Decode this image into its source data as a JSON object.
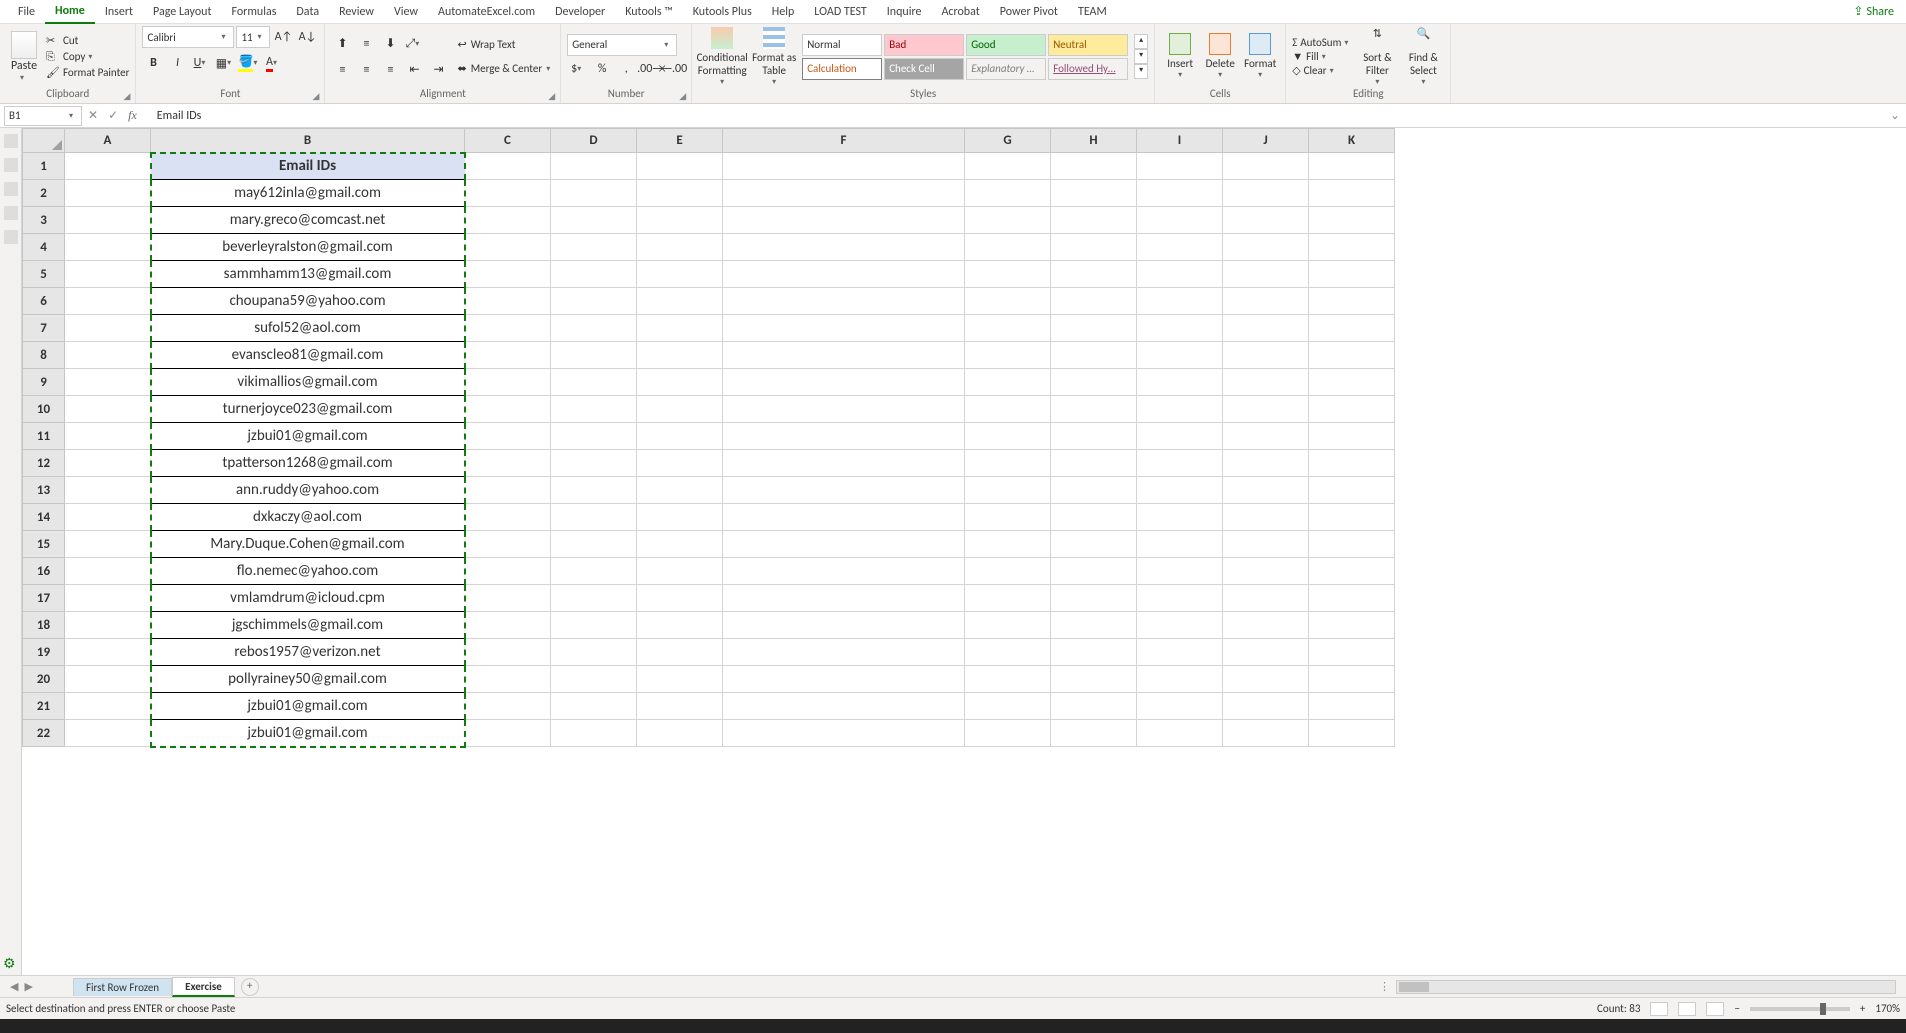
{
  "tabs": [
    "File",
    "Home",
    "Insert",
    "Page Layout",
    "Formulas",
    "Data",
    "Review",
    "View",
    "AutomateExcel.com",
    "Developer",
    "Kutools ™",
    "Kutools Plus",
    "Help",
    "LOAD TEST",
    "Inquire",
    "Acrobat",
    "Power Pivot",
    "TEAM"
  ],
  "active_tab": "Home",
  "share": "Share",
  "clipboard": {
    "paste": "Paste",
    "cut": "Cut",
    "copy": "Copy",
    "painter": "Format Painter",
    "label": "Clipboard"
  },
  "font": {
    "name": "Calibri",
    "size": "11",
    "label": "Font"
  },
  "alignment": {
    "wrap": "Wrap Text",
    "merge": "Merge & Center",
    "label": "Alignment"
  },
  "number": {
    "format": "General",
    "label": "Number"
  },
  "styles": {
    "cond": "Conditional Formatting",
    "table": "Format as Table",
    "g": [
      "Normal",
      "Bad",
      "Good",
      "Neutral",
      "Calculation",
      "Check Cell",
      "Explanatory …",
      "Followed Hy…"
    ],
    "label": "Styles"
  },
  "cells": {
    "insert": "Insert",
    "delete": "Delete",
    "format": "Format",
    "label": "Cells"
  },
  "editing": {
    "sum": "AutoSum",
    "fill": "Fill",
    "clear": "Clear",
    "sort": "Sort & Filter",
    "find": "Find & Select",
    "label": "Editing"
  },
  "namebox": "B1",
  "formula": "Email IDs",
  "columns": [
    "A",
    "B",
    "C",
    "D",
    "E",
    "F",
    "G",
    "H",
    "I",
    "J",
    "K"
  ],
  "rows": [
    "1",
    "2",
    "3",
    "4",
    "5",
    "6",
    "7",
    "8",
    "9",
    "10",
    "11",
    "12",
    "13",
    "14",
    "15",
    "16",
    "17",
    "18",
    "19",
    "20",
    "21",
    "22"
  ],
  "header_cell": "Email IDs",
  "emails": [
    "may612inla@gmail.com",
    "mary.greco@comcast.net",
    "beverleyralston@gmail.com",
    "sammhamm13@gmail.com",
    "choupana59@yahoo.com",
    "sufol52@aol.com",
    "evanscleo81@gmail.com",
    "vikimallios@gmail.com",
    "turnerjoyce023@gmail.com",
    "jzbui01@gmail.com",
    "tpatterson1268@gmail.com",
    "ann.ruddy@yahoo.com",
    "dxkaczy@aol.com",
    "Mary.Duque.Cohen@gmail.com",
    "flo.nemec@yahoo.com",
    "vmlamdrum@icloud.cpm",
    "jgschimmels@gmail.com",
    "rebos1957@verizon.net",
    "pollyrainey50@gmail.com",
    "jzbui01@gmail.com",
    "jzbui01@gmail.com"
  ],
  "sheets": {
    "s1": "First Row Frozen",
    "s2": "Exercise"
  },
  "status": {
    "msg": "Select destination and press ENTER or choose Paste",
    "count": "Count: 83",
    "zoom": "170%"
  }
}
